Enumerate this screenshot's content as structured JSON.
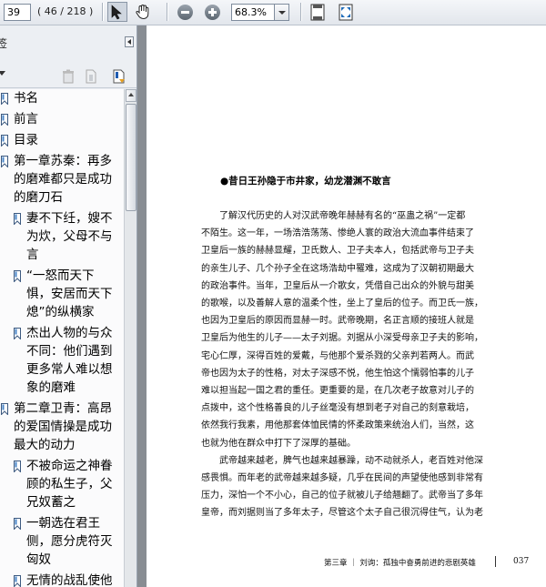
{
  "toolbar": {
    "page_input": "39",
    "page_count": "( 46 / 218 )",
    "zoom": "68.3%"
  },
  "panel": {
    "title": "签",
    "bookmarks": [
      {
        "text": "书名",
        "level": 0
      },
      {
        "text": "前言",
        "level": 0
      },
      {
        "text": "目录",
        "level": 0
      },
      {
        "text": "第一章苏秦：再多\n的磨难都只是成功\n的磨刀石",
        "level": 0
      },
      {
        "text": "妻不下纴，嫂不\n为炊，父母不与\n言",
        "level": 1
      },
      {
        "text": "“一怒而天下\n惧，安居而天下\n熄”的纵横家",
        "level": 1
      },
      {
        "text": "杰出人物的与众\n不同：他们遇到\n更多常人难以想\n象的磨难",
        "level": 1
      },
      {
        "text": "第二章卫青：高昂\n的爱国情操是成功\n最大的动力",
        "level": 0
      },
      {
        "text": "不被命运之神眷\n顾的私生子，父\n兄奴蓄之",
        "level": 1
      },
      {
        "text": "一朝选在君王\n侧，愿分虎符灭\n匈奴",
        "level": 1
      },
      {
        "text": "无情的战乱使他\n迷惑了自己",
        "level": 1
      }
    ]
  },
  "document": {
    "heading": "●昔日王孙隐于市井家，幼龙潜渊不敢言",
    "lines": [
      "　　了解汉代历史的人对汉武帝晚年赫赫有名的“巫蛊之祸”一定都",
      "不陌生。这一年，一场浩浩荡荡、惨绝人寰的政治大流血事件结束了",
      "卫皇后一族的赫赫显耀，卫氏数人、卫子夫本人，包括武帝与卫子夫",
      "的亲生儿子、几个孙子全在这场浩劫中罹难，这成为了汉朝初期最大",
      "的政治事件。当年，卫皇后从一介歌女，凭借自己出众的外貌与甜美",
      "的歌喉，以及善解人意的温柔个性，坐上了皇后的位子。而卫氏一族，",
      "也因为卫皇后的原因而显赫一时。武帝晚期，名正言顺的接班人就是",
      "卫皇后为他生的儿子——太子刘据。刘据从小深受母亲卫子夫的影响，",
      "宅心仁厚，深得百姓的爱戴，与他那个爱杀戮的父亲判若两人。而武",
      "帝也因为太子的性格，对太子深感不悦，他生怕这个懦弱怕事的儿子",
      "难以担当起一国之君的重任。更重要的是，在几次老子故意对儿子的",
      "点拨中，这个性格善良的儿子丝毫没有想到老子对自己的刻意栽培，",
      "依然我行我素，用他那套体恤民情的怀柔政策来统治人们，当然，这",
      "也就为他在群众中打下了深厚的基础。",
      "　　武帝越来越老，脾气也越来越暴躁，动不动就杀人，老百姓对他深",
      "感畏惧。而年老的武帝越来越多疑，几乎在民间的声望使他感到非常有",
      "压力，深怕一个不小心，自己的位子就被儿子给翘翻了。武帝当了多年",
      "皇帝，而刘据则当了多年太子，尽管这个太子自己很沉得住气，认为老"
    ],
    "footer": "第三章 ｜ 刘询：孤独中奋勇前进的悲剧英雄",
    "page_number": "037"
  }
}
